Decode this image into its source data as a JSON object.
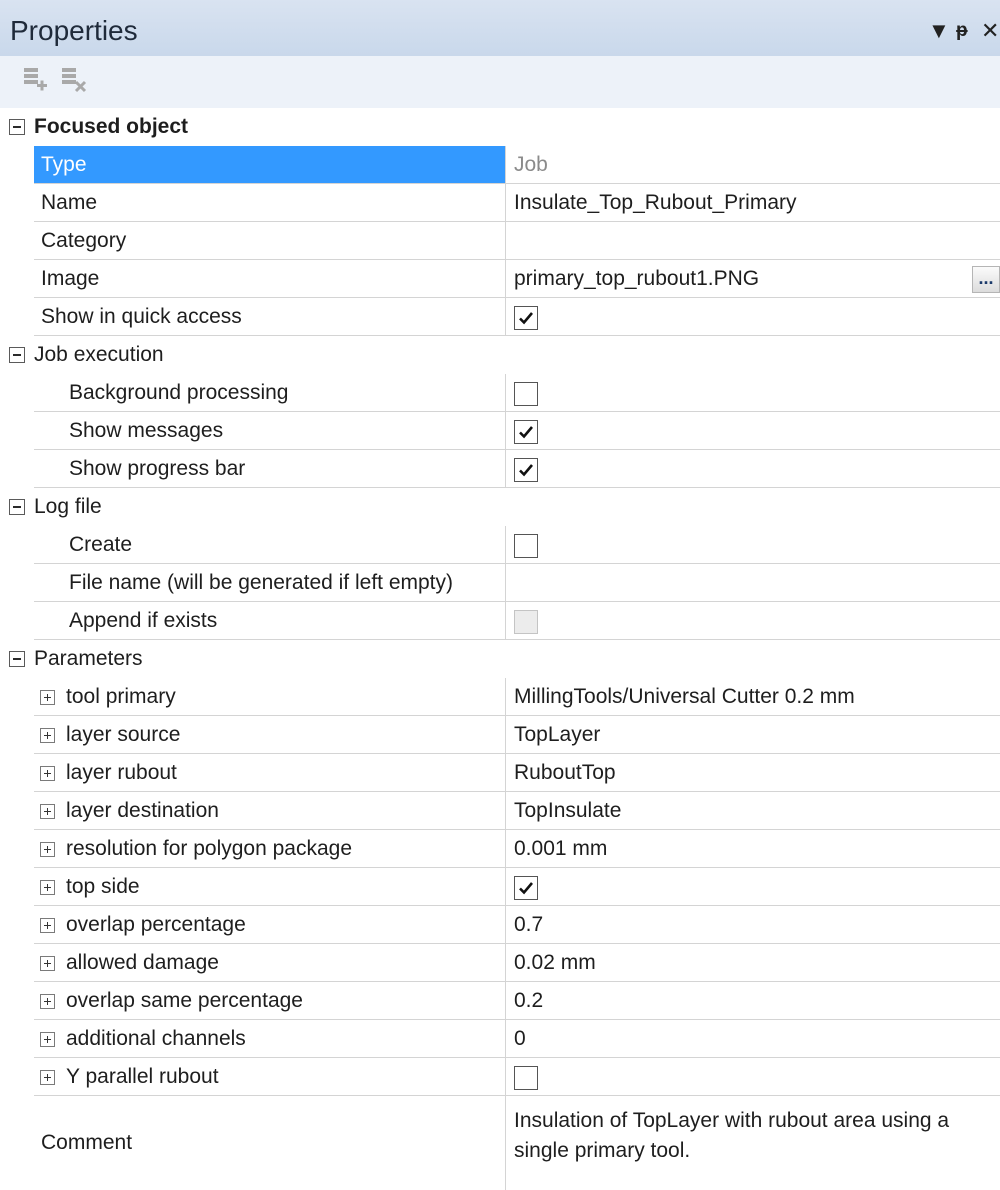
{
  "window": {
    "title": "Properties",
    "controls": {
      "dropdown": "▼",
      "pin": "ᵽ",
      "close": "✕"
    }
  },
  "toolbar": {
    "buttons": [
      {
        "icon": "add-item-icon"
      },
      {
        "icon": "remove-item-icon"
      }
    ]
  },
  "focused_object": {
    "label": "Focused object",
    "rows": [
      {
        "name": "Type",
        "value": "Job"
      },
      {
        "name": "Name",
        "value": "Insulate_Top_Rubout_Primary"
      },
      {
        "name": "Category",
        "value": ""
      },
      {
        "name": "Image",
        "value": "primary_top_rubout1.PNG",
        "button": "..."
      },
      {
        "name": "Show in quick access",
        "checked": true
      }
    ]
  },
  "job_execution": {
    "label": "Job execution",
    "rows": [
      {
        "name": "Background processing",
        "checked": false
      },
      {
        "name": "Show messages",
        "checked": true
      },
      {
        "name": "Show progress bar",
        "checked": true
      }
    ]
  },
  "log_file": {
    "label": "Log file",
    "rows": [
      {
        "name": "Create",
        "checked": false
      },
      {
        "name": "File name (will be generated if left empty)",
        "value": ""
      },
      {
        "name": "Append if exists",
        "checked": false,
        "disabled": true
      }
    ]
  },
  "parameters": {
    "label": "Parameters",
    "rows": [
      {
        "name": "tool primary",
        "value": "MillingTools/Universal Cutter 0.2 mm"
      },
      {
        "name": "layer source",
        "value": "TopLayer"
      },
      {
        "name": "layer rubout",
        "value": "RuboutTop"
      },
      {
        "name": "layer destination",
        "value": "TopInsulate"
      },
      {
        "name": "resolution for polygon package",
        "value": "0.001 mm"
      },
      {
        "name": "top side",
        "checked": true
      },
      {
        "name": "overlap percentage",
        "value": "0.7"
      },
      {
        "name": "allowed damage",
        "value": "0.02 mm"
      },
      {
        "name": "overlap same percentage",
        "value": "0.2"
      },
      {
        "name": "additional channels",
        "value": "0"
      },
      {
        "name": "Y parallel rubout",
        "checked": false
      }
    ]
  },
  "comment": {
    "name": "Comment",
    "value": "Insulation of TopLayer with rubout area using a single primary tool."
  },
  "colors": {
    "selection": "#3399ff",
    "titlebar": "#c6d6ea",
    "gridline": "#d4d4d4"
  }
}
